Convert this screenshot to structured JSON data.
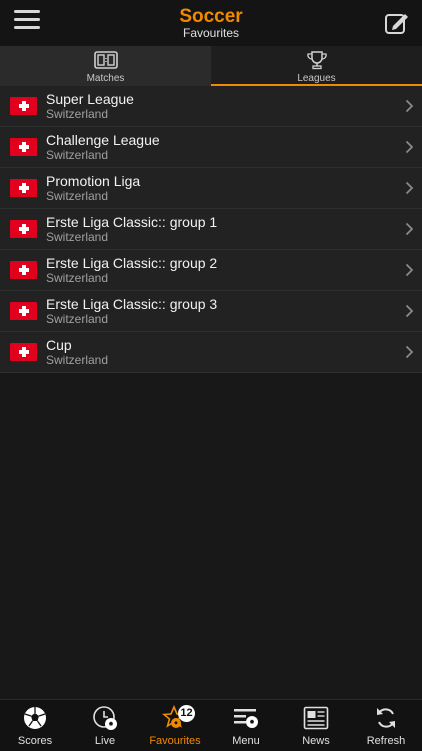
{
  "header": {
    "title": "Soccer",
    "subtitle": "Favourites"
  },
  "tabs": [
    {
      "label": "Matches",
      "icon": "scoreboard-icon",
      "selected": false
    },
    {
      "label": "Leagues",
      "icon": "trophy-icon",
      "selected": true
    }
  ],
  "leagues": [
    {
      "name": "Super League",
      "country": "Switzerland",
      "flag": "switzerland-flag-icon"
    },
    {
      "name": "Challenge League",
      "country": "Switzerland",
      "flag": "switzerland-flag-icon"
    },
    {
      "name": "Promotion Liga",
      "country": "Switzerland",
      "flag": "switzerland-flag-icon"
    },
    {
      "name": "Erste Liga Classic:: group 1",
      "country": "Switzerland",
      "flag": "switzerland-flag-icon"
    },
    {
      "name": "Erste Liga Classic:: group 2",
      "country": "Switzerland",
      "flag": "switzerland-flag-icon"
    },
    {
      "name": "Erste Liga Classic:: group 3",
      "country": "Switzerland",
      "flag": "switzerland-flag-icon"
    },
    {
      "name": "Cup",
      "country": "Switzerland",
      "flag": "switzerland-flag-icon"
    }
  ],
  "bottom_nav": [
    {
      "label": "Scores",
      "icon": "soccer-ball-icon"
    },
    {
      "label": "Live",
      "icon": "live-clock-ball-icon"
    },
    {
      "label": "Favourites",
      "icon": "star-ball-icon",
      "badge": "12",
      "active": true
    },
    {
      "label": "Menu",
      "icon": "menu-list-ball-icon"
    },
    {
      "label": "News",
      "icon": "newspaper-icon"
    },
    {
      "label": "Refresh",
      "icon": "refresh-icon"
    }
  ],
  "colors": {
    "accent": "#f08a00",
    "background": "#181818",
    "row": "#222222",
    "flag_red": "#e1001e"
  }
}
